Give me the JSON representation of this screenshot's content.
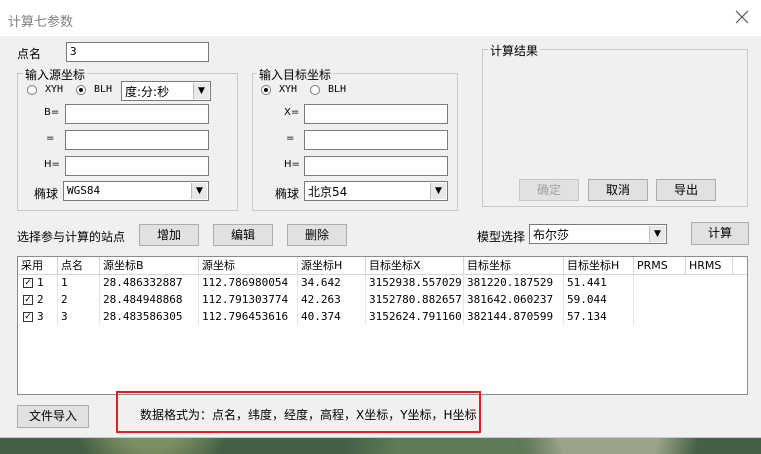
{
  "window": {
    "title": "计算七参数"
  },
  "point_name": {
    "label": "点名",
    "value": "3"
  },
  "source": {
    "group_title": "输入源坐标",
    "mode_xyh": "XYH",
    "mode_blh": "BLH",
    "selected_mode": "BLH",
    "format_value": "度:分:秒",
    "field1_label": "B=",
    "field2_label": "=",
    "field3_label": "H=",
    "ellipsoid_label": "椭球",
    "ellipsoid_value": "WGS84"
  },
  "target": {
    "group_title": "输入目标坐标",
    "mode_xyh": "XYH",
    "mode_blh": "BLH",
    "selected_mode": "XYH",
    "field1_label": "X=",
    "field2_label": "=",
    "field3_label": "H=",
    "ellipsoid_label": "椭球",
    "ellipsoid_value": "北京54"
  },
  "result": {
    "group_title": "计算结果",
    "confirm_label": "确定",
    "cancel_label": "取消",
    "export_label": "导出"
  },
  "stations": {
    "label": "选择参与计算的站点",
    "add_label": "增加",
    "edit_label": "编辑",
    "delete_label": "删除"
  },
  "model": {
    "label": "模型选择",
    "value": "布尔莎",
    "compute_label": "计算"
  },
  "table": {
    "columns": [
      "采用",
      "点名",
      "源坐标B",
      "源坐标",
      "源坐标H",
      "目标坐标X",
      "目标坐标",
      "目标坐标H",
      "PRMS",
      "HRMS"
    ],
    "rows": [
      {
        "use": "1",
        "name": "1",
        "b": "28.486332887",
        "l": "112.786980054",
        "h": "34.642",
        "x": "3152938.557029",
        "y": "381220.187529",
        "th": "51.441"
      },
      {
        "use": "2",
        "name": "2",
        "b": "28.484948868",
        "l": "112.791303774",
        "h": "42.263",
        "x": "3152780.882657",
        "y": "381642.060237",
        "th": "59.044"
      },
      {
        "use": "3",
        "name": "3",
        "b": "28.483586305",
        "l": "112.796453616",
        "h": "40.374",
        "x": "3152624.791160",
        "y": "382144.870599",
        "th": "57.134"
      }
    ]
  },
  "footer": {
    "import_label": "文件导入",
    "format_note": "数据格式为：点名，纬度，经度，高程，X坐标，Y坐标，H坐标"
  },
  "colors": {
    "highlight_border": "#e02020"
  }
}
